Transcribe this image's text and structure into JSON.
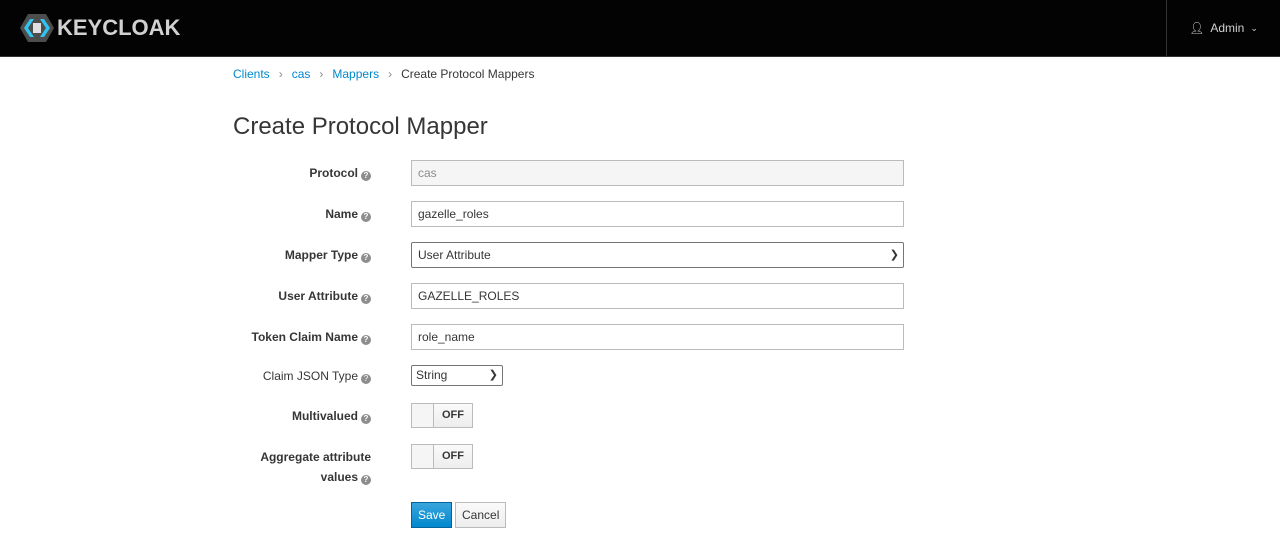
{
  "header": {
    "brand": "KEYCLOAK",
    "user": "Admin"
  },
  "breadcrumb": [
    "Clients",
    "cas",
    "Mappers",
    "Create Protocol Mappers"
  ],
  "title": "Create Protocol Mapper",
  "form": {
    "protocol": {
      "label": "Protocol",
      "value": "cas"
    },
    "name": {
      "label": "Name",
      "value": "gazelle_roles"
    },
    "mapper_type": {
      "label": "Mapper Type",
      "value": "User Attribute"
    },
    "user_attribute": {
      "label": "User Attribute",
      "value": "GAZELLE_ROLES"
    },
    "token_claim_name": {
      "label": "Token Claim Name",
      "value": "role_name"
    },
    "claim_json_type": {
      "label": "Claim JSON Type",
      "value": "String"
    },
    "multivalued": {
      "label": "Multivalued",
      "value": "OFF"
    },
    "aggregate": {
      "label1": "Aggregate attribute",
      "label2": "values",
      "value": "OFF"
    }
  },
  "buttons": {
    "save": "Save",
    "cancel": "Cancel"
  },
  "colors": {
    "primary": "#0088ce",
    "nav": "#030303"
  }
}
